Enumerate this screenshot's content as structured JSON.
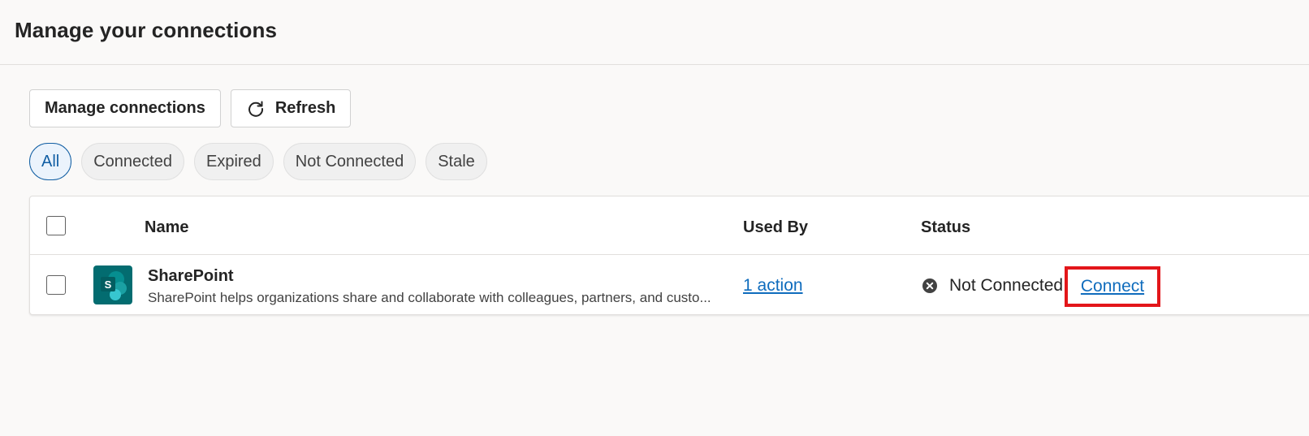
{
  "page": {
    "title": "Manage your connections"
  },
  "toolbar": {
    "manage_label": "Manage connections",
    "refresh_label": "Refresh",
    "refresh_icon": "refresh-icon"
  },
  "filters": [
    {
      "label": "All",
      "active": true
    },
    {
      "label": "Connected",
      "active": false
    },
    {
      "label": "Expired",
      "active": false
    },
    {
      "label": "Not Connected",
      "active": false
    },
    {
      "label": "Stale",
      "active": false
    }
  ],
  "table": {
    "columns": {
      "name": "Name",
      "used_by": "Used By",
      "status": "Status"
    },
    "rows": [
      {
        "name": "SharePoint",
        "description": "SharePoint helps organizations share and collaborate with colleagues, partners, and custo...",
        "icon": "sharepoint-icon",
        "used_by": "1 action",
        "status": "Not Connected",
        "status_icon": "error-circle-icon",
        "action_label": "Connect"
      }
    ]
  },
  "colors": {
    "accent": "#0f6cbd",
    "highlight": "#e3161a",
    "sharepoint": "#036c70",
    "active_chip_border": "#115ea3"
  }
}
